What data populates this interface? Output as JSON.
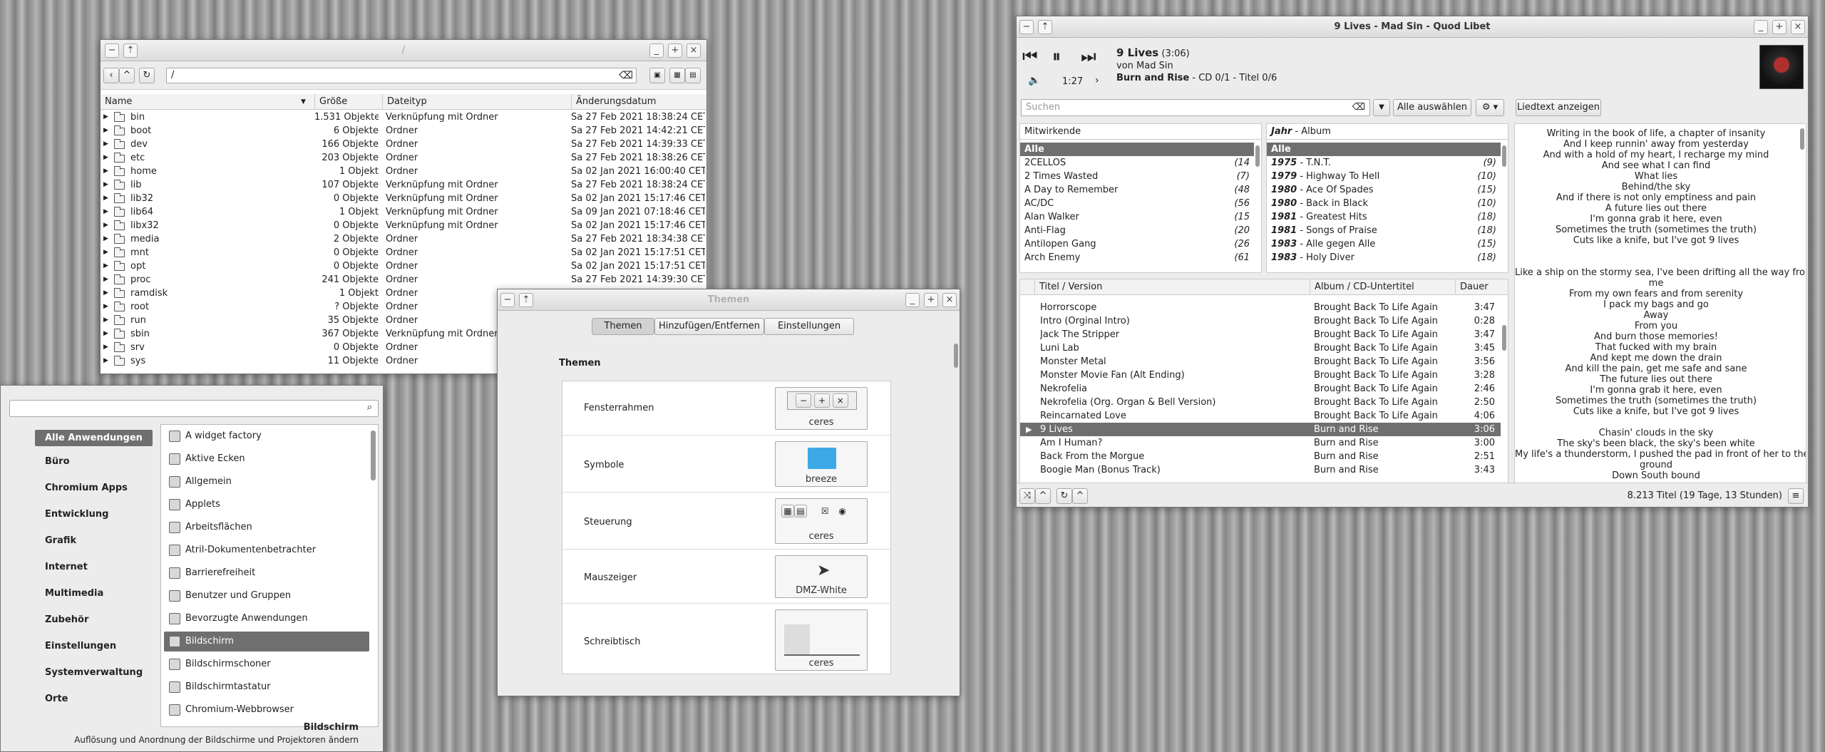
{
  "file_manager": {
    "title": "/",
    "path": "/",
    "columns": [
      "Name",
      "Größe",
      "Dateityp",
      "Änderungsdatum"
    ],
    "rows": [
      {
        "name": "bin",
        "size": "1.531 Objekte",
        "type": "Verknüpfung mit Ordner",
        "date": "Sa 27 Feb 2021 18:38:24 CET"
      },
      {
        "name": "boot",
        "size": "6 Objekte",
        "type": "Ordner",
        "date": "Sa 27 Feb 2021 14:42:21 CET"
      },
      {
        "name": "dev",
        "size": "166 Objekte",
        "type": "Ordner",
        "date": "Sa 27 Feb 2021 14:39:33 CET"
      },
      {
        "name": "etc",
        "size": "203 Objekte",
        "type": "Ordner",
        "date": "Sa 27 Feb 2021 18:38:26 CET"
      },
      {
        "name": "home",
        "size": "1 Objekt",
        "type": "Ordner",
        "date": "Sa 02 Jan 2021 16:00:40 CET"
      },
      {
        "name": "lib",
        "size": "107 Objekte",
        "type": "Verknüpfung mit Ordner",
        "date": "Sa 27 Feb 2021 18:38:24 CET"
      },
      {
        "name": "lib32",
        "size": "0 Objekte",
        "type": "Verknüpfung mit Ordner",
        "date": "Sa 02 Jan 2021 15:17:46 CET"
      },
      {
        "name": "lib64",
        "size": "1 Objekt",
        "type": "Verknüpfung mit Ordner",
        "date": "Sa 09 Jan 2021 07:18:46 CET"
      },
      {
        "name": "libx32",
        "size": "0 Objekte",
        "type": "Verknüpfung mit Ordner",
        "date": "Sa 02 Jan 2021 15:17:46 CET"
      },
      {
        "name": "media",
        "size": "2 Objekte",
        "type": "Ordner",
        "date": "Sa 27 Feb 2021 18:34:38 CET"
      },
      {
        "name": "mnt",
        "size": "0 Objekte",
        "type": "Ordner",
        "date": "Sa 02 Jan 2021 15:17:51 CET"
      },
      {
        "name": "opt",
        "size": "0 Objekte",
        "type": "Ordner",
        "date": "Sa 02 Jan 2021 15:17:51 CET"
      },
      {
        "name": "proc",
        "size": "241 Objekte",
        "type": "Ordner",
        "date": "Sa 27 Feb 2021 14:39:30 CET"
      },
      {
        "name": "ramdisk",
        "size": "1 Objekt",
        "type": "Ordner",
        "date": ""
      },
      {
        "name": "root",
        "size": "? Objekte",
        "type": "Ordner",
        "date": ""
      },
      {
        "name": "run",
        "size": "35 Objekte",
        "type": "Ordner",
        "date": ""
      },
      {
        "name": "sbin",
        "size": "367 Objekte",
        "type": "Verknüpfung mit Ordner",
        "date": ""
      },
      {
        "name": "srv",
        "size": "0 Objekte",
        "type": "Ordner",
        "date": ""
      },
      {
        "name": "sys",
        "size": "11 Objekte",
        "type": "Ordner",
        "date": ""
      }
    ]
  },
  "app_menu": {
    "search_placeholder": "",
    "categories": [
      "Alle Anwendungen",
      "Büro",
      "Chromium Apps",
      "Entwicklung",
      "Grafik",
      "Internet",
      "Multimedia",
      "Zubehör",
      "Einstellungen",
      "Systemverwaltung",
      "Orte"
    ],
    "apps": [
      "A widget factory",
      "Aktive Ecken",
      "Allgemein",
      "Applets",
      "Arbeitsflächen",
      "Atril-Dokumentenbetrachter",
      "Barrierefreiheit",
      "Benutzer und Gruppen",
      "Bevorzugte Anwendungen",
      "Bildschirm",
      "Bildschirmschoner",
      "Bildschirmtastatur",
      "Chromium-Webbrowser"
    ],
    "selected_app": "Bildschirm",
    "footer_title": "Bildschirm",
    "footer_desc": "Auflösung und Anordnung der Bildschirme und Projektoren ändern"
  },
  "themes": {
    "title": "Themen",
    "tabs": [
      "Themen",
      "Hinzufügen/Entfernen",
      "Einstellungen"
    ],
    "heading": "Themen",
    "rows": [
      {
        "label": "Fensterrahmen",
        "value": "ceres"
      },
      {
        "label": "Symbole",
        "value": "breeze"
      },
      {
        "label": "Steuerung",
        "value": "ceres"
      },
      {
        "label": "Mauszeiger",
        "value": "DMZ-White"
      },
      {
        "label": "Schreibtisch",
        "value": "ceres"
      }
    ]
  },
  "player": {
    "title": "9 Lives - Mad Sin - Quod Libet",
    "song_title": "9 Lives",
    "song_len": "(3:06)",
    "artist_line": "von Mad Sin",
    "album": "Burn and Rise",
    "album_info": " - CD 0/1 - Titel 0/6",
    "position": "1:27",
    "search_placeholder": "Suchen",
    "select_all": "Alle auswählen",
    "lyrics_button": "Liedtext anzeigen",
    "artists_header": "Mitwirkende",
    "albums_header_bold": "Jahr",
    "albums_header_rest": " - Album",
    "artists": [
      {
        "name": "Alle",
        "count": ""
      },
      {
        "name": "2CELLOS",
        "count": "(14"
      },
      {
        "name": "2 Times Wasted",
        "count": "(7)"
      },
      {
        "name": "A Day to Remember",
        "count": "(48"
      },
      {
        "name": "AC/DC",
        "count": "(56"
      },
      {
        "name": "Alan Walker",
        "count": "(15"
      },
      {
        "name": "Anti-Flag",
        "count": "(20"
      },
      {
        "name": "Antilopen Gang",
        "count": "(26"
      },
      {
        "name": "Arch Enemy",
        "count": "(61"
      }
    ],
    "albums": [
      {
        "year": "",
        "name": "Alle",
        "count": ""
      },
      {
        "year": "1975",
        "name": " - T.N.T.",
        "count": "(9)"
      },
      {
        "year": "1979",
        "name": " - Highway To Hell",
        "count": "(10)"
      },
      {
        "year": "1980",
        "name": " - Ace Of Spades",
        "count": "(15)"
      },
      {
        "year": "1980",
        "name": " - Back in Black",
        "count": "(10)"
      },
      {
        "year": "1981",
        "name": " - Greatest Hits",
        "count": "(18)"
      },
      {
        "year": "1981",
        "name": " - Songs of Praise",
        "count": "(18)"
      },
      {
        "year": "1983",
        "name": " - Alle gegen Alle",
        "count": "(15)"
      },
      {
        "year": "1983",
        "name": " - Holy Diver",
        "count": "(18)"
      }
    ],
    "playlist_columns": [
      "Titel / Version",
      "Album / CD-Untertitel",
      "Dauer"
    ],
    "playlist": [
      {
        "title": "Horrorscope",
        "album": "Brought Back To Life Again",
        "dur": "3:47"
      },
      {
        "title": "Intro (Orginal Intro)",
        "album": "Brought Back To Life Again",
        "dur": "0:28"
      },
      {
        "title": "Jack The Stripper",
        "album": "Brought Back To Life Again",
        "dur": "3:47"
      },
      {
        "title": "Luni Lab",
        "album": "Brought Back To Life Again",
        "dur": "3:45"
      },
      {
        "title": "Monster Metal",
        "album": "Brought Back To Life Again",
        "dur": "3:56"
      },
      {
        "title": "Monster Movie Fan (Alt Ending)",
        "album": "Brought Back To Life Again",
        "dur": "3:28"
      },
      {
        "title": "Nekrofelia",
        "album": "Brought Back To Life Again",
        "dur": "2:46"
      },
      {
        "title": "Nekrofelia (Org. Organ & Bell Version)",
        "album": "Brought Back To Life Again",
        "dur": "2:50"
      },
      {
        "title": "Reincarnated Love",
        "album": "Brought Back To Life Again",
        "dur": "4:06"
      },
      {
        "title": "9 Lives",
        "album": "Burn and Rise",
        "dur": "3:06"
      },
      {
        "title": "Am I Human?",
        "album": "Burn and Rise",
        "dur": "3:00"
      },
      {
        "title": "Back From the Morgue",
        "album": "Burn and Rise",
        "dur": "2:51"
      },
      {
        "title": "Boogie Man (Bonus Track)",
        "album": "Burn and Rise",
        "dur": "3:43"
      }
    ],
    "playing_index": 9,
    "lyrics": [
      "Writing in the book of life, a chapter of insanity",
      "And I keep runnin' away from yesterday",
      "And with a hold of my heart, I recharge my mind",
      "And see what I can find",
      "What lies",
      "Behind/the sky",
      "And if there is not only emptiness and pain",
      "A future lies out there",
      "I'm gonna grab it here, even",
      "Sometimes the truth (sometimes the truth)",
      "Cuts like a knife, but I've got 9 lives",
      "",
      "",
      "Like a ship on the stormy sea, I've been drifting all the way from",
      "me",
      "From my own fears and from serenity",
      "I pack my bags and go",
      "Away",
      "From you",
      "And burn those memories!",
      "That fucked with my brain",
      "And kept me down the drain",
      "And kill the pain, get me safe and sane",
      "The future lies out there",
      "I'm gonna grab it here, even",
      "Sometimes the truth (sometimes the truth)",
      "Cuts like a knife, but I've got 9 lives",
      "",
      "Chasin' clouds in the sky",
      "The sky's been black, the sky's been white",
      "My life's a thunderstorm, I pushed the pad in front of her to the",
      "ground",
      "Down South bound"
    ],
    "status": "8.213 Titel (19 Tage, 13 Stunden)"
  }
}
